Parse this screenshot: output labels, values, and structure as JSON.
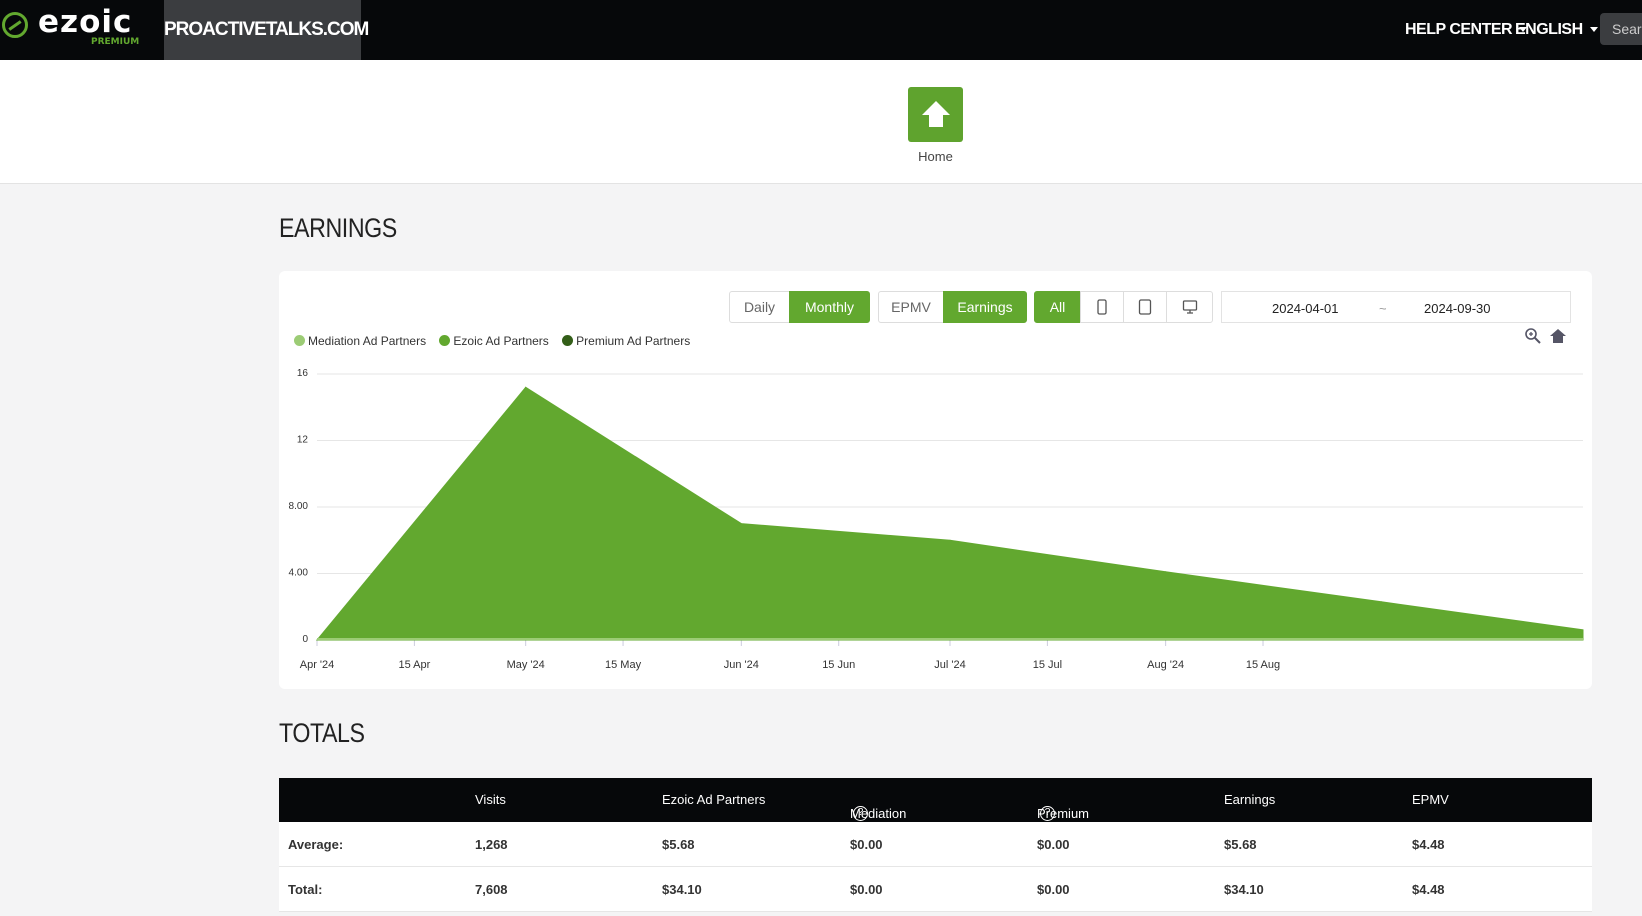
{
  "header": {
    "logo_text": "ezoic",
    "logo_sub": "PREMIUM",
    "site_name": "PROACTIVETALKS.COM",
    "help_center": "HELP CENTER",
    "language": "ENGLISH",
    "search_placeholder": "Searc"
  },
  "home": {
    "label": "Home"
  },
  "earnings": {
    "title": "EARNINGS",
    "buttons": {
      "daily": "Daily",
      "monthly": "Monthly",
      "epmv": "EPMV",
      "earnings": "Earnings",
      "all": "All"
    },
    "date_from": "2024-04-01",
    "date_sep": "~",
    "date_to": "2024-09-30"
  },
  "chart_data": {
    "type": "area",
    "title": "",
    "ylim": [
      0,
      16
    ],
    "yticks": [
      "0",
      "4.00",
      "8.00",
      "12",
      "16"
    ],
    "xticks": [
      "Apr '24",
      "15 Apr",
      "May '24",
      "15 May",
      "Jun '24",
      "15 Jun",
      "Jul '24",
      "15 Jul",
      "Aug '24",
      "15 Aug"
    ],
    "legend": [
      "Mediation Ad Partners",
      "Ezoic Ad Partners",
      "Premium Ad Partners"
    ],
    "legend_colors": [
      "#9ccc75",
      "#62a82f",
      "#335e18"
    ],
    "series": [
      {
        "name": "Ezoic Ad Partners",
        "x": [
          "2024-04-01",
          "2024-05-01",
          "2024-06-01",
          "2024-07-01",
          "2024-08-01",
          "2024-09-01"
        ],
        "values": [
          0,
          15.2,
          7.0,
          6.0,
          4.1,
          2.3
        ],
        "color": "#62a82f"
      }
    ],
    "grid": true,
    "legend_position": "top-left"
  },
  "totals": {
    "title": "TOTALS",
    "columns": [
      "",
      "Visits",
      "Ezoic Ad Partners",
      "Mediation Ad Partners",
      "Premium Ad Partners",
      "Earnings",
      "EPMV"
    ],
    "rows": [
      [
        "Average:",
        "1,268",
        "$5.68",
        "$0.00",
        "$0.00",
        "$5.68",
        "$4.48"
      ],
      [
        "Total:",
        "7,608",
        "$34.10",
        "$0.00",
        "$0.00",
        "$34.10",
        "$4.48"
      ]
    ]
  }
}
